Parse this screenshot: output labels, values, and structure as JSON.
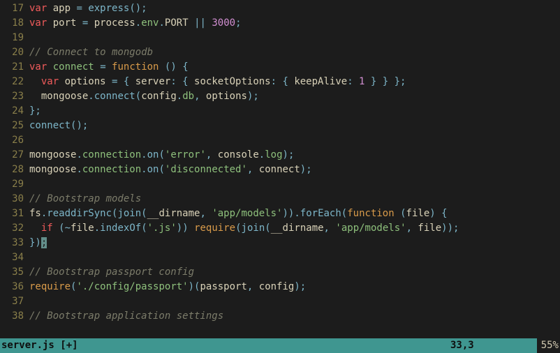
{
  "status": {
    "filename": "server.js",
    "modified_flag": "[+]",
    "cursor_pos": "33,3",
    "percent": "55%"
  },
  "gutter": [
    "17",
    "18",
    "19",
    "20",
    "21",
    "22",
    "23",
    "24",
    "25",
    "26",
    "27",
    "28",
    "29",
    "30",
    "31",
    "32",
    "33",
    "34",
    "35",
    "36",
    "37",
    "38"
  ],
  "code_lines_plain": [
    "var app = express();",
    "var port = process.env.PORT || 3000;",
    "",
    "// Connect to mongodb",
    "var connect = function () {",
    "  var options = { server: { socketOptions: { keepAlive: 1 } } };",
    "  mongoose.connect(config.db, options);",
    "};",
    "connect();",
    "",
    "mongoose.connection.on('error', console.log);",
    "mongoose.connection.on('disconnected', connect);",
    "",
    "// Bootstrap models",
    "fs.readdirSync(join(__dirname, 'app/models')).forEach(function (file) {",
    "  if (~file.indexOf('.js')) require(join(__dirname, 'app/models', file));",
    "});",
    "",
    "// Bootstrap passport config",
    "require('./config/passport')(passport, config);",
    "",
    "// Bootstrap application settings"
  ],
  "lines": [
    {
      "n": "17",
      "t": [
        [
          "kw",
          "var"
        ],
        [
          "ident",
          " app "
        ],
        [
          "op",
          "= "
        ],
        [
          "fn2",
          "express"
        ],
        [
          "op",
          "();"
        ]
      ]
    },
    {
      "n": "18",
      "t": [
        [
          "kw",
          "var"
        ],
        [
          "ident",
          " port "
        ],
        [
          "op",
          "= "
        ],
        [
          "ident",
          "process"
        ],
        [
          "op",
          "."
        ],
        [
          "fn",
          "env"
        ],
        [
          "op",
          "."
        ],
        [
          "ident",
          "PORT "
        ],
        [
          "op",
          "|| "
        ],
        [
          "num",
          "3000"
        ],
        [
          "op",
          ";"
        ]
      ]
    },
    {
      "n": "19",
      "t": [
        [
          "ident",
          ""
        ]
      ]
    },
    {
      "n": "20",
      "t": [
        [
          "cmt",
          "// Connect to mongodb"
        ]
      ]
    },
    {
      "n": "21",
      "t": [
        [
          "kw",
          "var"
        ],
        [
          "ident",
          " "
        ],
        [
          "fn",
          "connect"
        ],
        [
          "ident",
          " "
        ],
        [
          "op",
          "= "
        ],
        [
          "kw2",
          "function"
        ],
        [
          "ident",
          " "
        ],
        [
          "op",
          "() {"
        ]
      ]
    },
    {
      "n": "22",
      "t": [
        [
          "ident",
          "  "
        ],
        [
          "kw",
          "var"
        ],
        [
          "ident",
          " options "
        ],
        [
          "op",
          "= { "
        ],
        [
          "ident",
          "server"
        ],
        [
          "op",
          ": { "
        ],
        [
          "ident",
          "socketOptions"
        ],
        [
          "op",
          ": { "
        ],
        [
          "ident",
          "keepAlive"
        ],
        [
          "op",
          ": "
        ],
        [
          "num",
          "1"
        ],
        [
          "op",
          " } } };"
        ]
      ]
    },
    {
      "n": "23",
      "t": [
        [
          "ident",
          "  mongoose"
        ],
        [
          "op",
          "."
        ],
        [
          "fn2",
          "connect"
        ],
        [
          "op",
          "("
        ],
        [
          "ident",
          "config"
        ],
        [
          "op",
          "."
        ],
        [
          "fn",
          "db"
        ],
        [
          "op",
          ", "
        ],
        [
          "ident",
          "options"
        ],
        [
          "op",
          ");"
        ]
      ]
    },
    {
      "n": "24",
      "t": [
        [
          "op",
          "};"
        ]
      ]
    },
    {
      "n": "25",
      "t": [
        [
          "fn2",
          "connect"
        ],
        [
          "op",
          "();"
        ]
      ]
    },
    {
      "n": "26",
      "t": [
        [
          "ident",
          ""
        ]
      ]
    },
    {
      "n": "27",
      "t": [
        [
          "ident",
          "mongoose"
        ],
        [
          "op",
          "."
        ],
        [
          "fn",
          "connection"
        ],
        [
          "op",
          "."
        ],
        [
          "fn2",
          "on"
        ],
        [
          "op",
          "("
        ],
        [
          "str",
          "'error'"
        ],
        [
          "op",
          ", "
        ],
        [
          "ident",
          "console"
        ],
        [
          "op",
          "."
        ],
        [
          "fn",
          "log"
        ],
        [
          "op",
          ");"
        ]
      ]
    },
    {
      "n": "28",
      "t": [
        [
          "ident",
          "mongoose"
        ],
        [
          "op",
          "."
        ],
        [
          "fn",
          "connection"
        ],
        [
          "op",
          "."
        ],
        [
          "fn2",
          "on"
        ],
        [
          "op",
          "("
        ],
        [
          "str",
          "'disconnected'"
        ],
        [
          "op",
          ", "
        ],
        [
          "ident",
          "connect"
        ],
        [
          "op",
          ");"
        ]
      ]
    },
    {
      "n": "29",
      "t": [
        [
          "ident",
          ""
        ]
      ]
    },
    {
      "n": "30",
      "t": [
        [
          "cmt",
          "// Bootstrap models"
        ]
      ]
    },
    {
      "n": "31",
      "t": [
        [
          "ident",
          "fs"
        ],
        [
          "op",
          "."
        ],
        [
          "fn2",
          "readdirSync"
        ],
        [
          "op",
          "("
        ],
        [
          "fn2",
          "join"
        ],
        [
          "op",
          "("
        ],
        [
          "ident",
          "__dirname"
        ],
        [
          "op",
          ", "
        ],
        [
          "str",
          "'app/models'"
        ],
        [
          "op",
          "))."
        ],
        [
          "fn2",
          "forEach"
        ],
        [
          "op",
          "("
        ],
        [
          "kw2",
          "function"
        ],
        [
          "ident",
          " "
        ],
        [
          "op",
          "("
        ],
        [
          "ident",
          "file"
        ],
        [
          "op",
          ") {"
        ]
      ]
    },
    {
      "n": "32",
      "t": [
        [
          "ident",
          "  "
        ],
        [
          "kw",
          "if"
        ],
        [
          "ident",
          " "
        ],
        [
          "op",
          "(~"
        ],
        [
          "ident",
          "file"
        ],
        [
          "op",
          "."
        ],
        [
          "fn2",
          "indexOf"
        ],
        [
          "op",
          "("
        ],
        [
          "str",
          "'.js'"
        ],
        [
          "op",
          ")) "
        ],
        [
          "kw2",
          "require"
        ],
        [
          "op",
          "("
        ],
        [
          "fn2",
          "join"
        ],
        [
          "op",
          "("
        ],
        [
          "ident",
          "__dirname"
        ],
        [
          "op",
          ", "
        ],
        [
          "str",
          "'app/models'"
        ],
        [
          "op",
          ", "
        ],
        [
          "ident",
          "file"
        ],
        [
          "op",
          "));"
        ]
      ]
    },
    {
      "n": "33",
      "t": [
        [
          "op",
          "})"
        ],
        [
          "cursor",
          ";"
        ]
      ]
    },
    {
      "n": "34",
      "t": [
        [
          "ident",
          ""
        ]
      ]
    },
    {
      "n": "35",
      "t": [
        [
          "cmt",
          "// Bootstrap passport config"
        ]
      ]
    },
    {
      "n": "36",
      "t": [
        [
          "kw2",
          "require"
        ],
        [
          "op",
          "("
        ],
        [
          "str",
          "'./config/passport'"
        ],
        [
          "op",
          ")("
        ],
        [
          "ident",
          "passport"
        ],
        [
          "op",
          ", "
        ],
        [
          "ident",
          "config"
        ],
        [
          "op",
          ");"
        ]
      ]
    },
    {
      "n": "37",
      "t": [
        [
          "ident",
          ""
        ]
      ]
    },
    {
      "n": "38",
      "t": [
        [
          "cmt",
          "// Bootstrap application settings"
        ]
      ]
    }
  ]
}
